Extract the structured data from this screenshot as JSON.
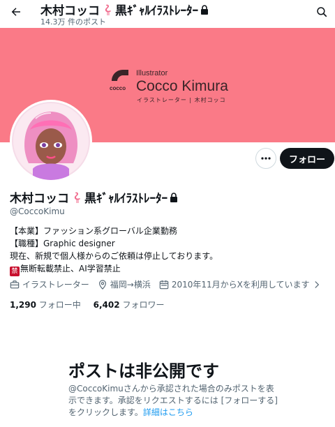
{
  "header": {
    "title": "木村コッコ",
    "title_suffix": "黒ｷﾞｬﾙｲﾗｽﾄﾚｰﾀｰ",
    "post_count": "14.3万 件のポスト",
    "icons": [
      "back-arrow-icon",
      "flamingo-icon",
      "lock-icon",
      "search-icon"
    ]
  },
  "banner": {
    "color": "#fa7a87",
    "small_text": "Illustrator",
    "big_text": "Cocco Kimura",
    "jp_text": "イラストレーター | 木村コッコ",
    "logo_text": "cocco"
  },
  "actions": {
    "more_icon": "more-dots-icon",
    "follow_label": "フォロー"
  },
  "profile": {
    "name": "木村コッコ",
    "name_suffix": "黒ｷﾞｬﾙｲﾗｽﾄﾚｰﾀｰ",
    "handle": "@CoccoKimu",
    "bio": [
      "【本業】ファッション系グローバル企業勤務",
      "【職種】Graphic designer",
      "現在、新規で個人様からのご依頼は停止しております。",
      "無断転載禁止、AI学習禁止"
    ],
    "prohibited_badge": "禁",
    "category": "イラストレーター",
    "location": "福岡→横浜",
    "joined": "2010年11月からXを利用しています",
    "following_count": "1,290",
    "following_label": "フォロー中",
    "followers_count": "6,402",
    "followers_label": "フォロワー"
  },
  "private_notice": {
    "title": "ポストは非公開です",
    "body": "@CoccoKimuさんから承認された場合のみポストを表示できます。承認をリクエストするには [フォローする] をクリックします。",
    "link": "詳細はこちら"
  },
  "colors": {
    "accent": "#1d9bf0",
    "text": "#0f1419",
    "muted": "#536471",
    "follow_bg": "#0f1419",
    "badge": "#c8102e"
  }
}
